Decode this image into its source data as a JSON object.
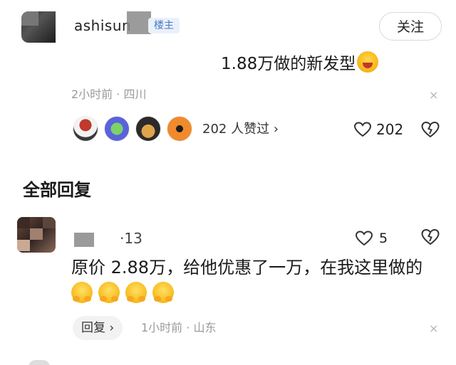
{
  "main_comment": {
    "username": "ashisun",
    "badge": "楼主",
    "follow_label": "关注",
    "text": "1.88万做的新发型",
    "emoji_icon": "laughing-face-emoji",
    "time_location": "2小时前 · 四川",
    "likers_summary": "202 人赞过 ›",
    "like_count": "202",
    "close_glyph": "×"
  },
  "section": {
    "title": "全部回复"
  },
  "reply": {
    "username": "·13",
    "like_count": "5",
    "text": "原价 2.88万，给他优惠了一万，在我这里做的",
    "emoji_icon": "hugging-face-emoji",
    "emoji_count": 4,
    "reply_button_label": "回复 ›",
    "time_location": "1小时前 · 山东",
    "close_glyph": "×"
  },
  "colors": {
    "badge_text": "#4a78c2",
    "badge_bg": "#eaf1fb",
    "meta_text": "#9a9a9a"
  }
}
